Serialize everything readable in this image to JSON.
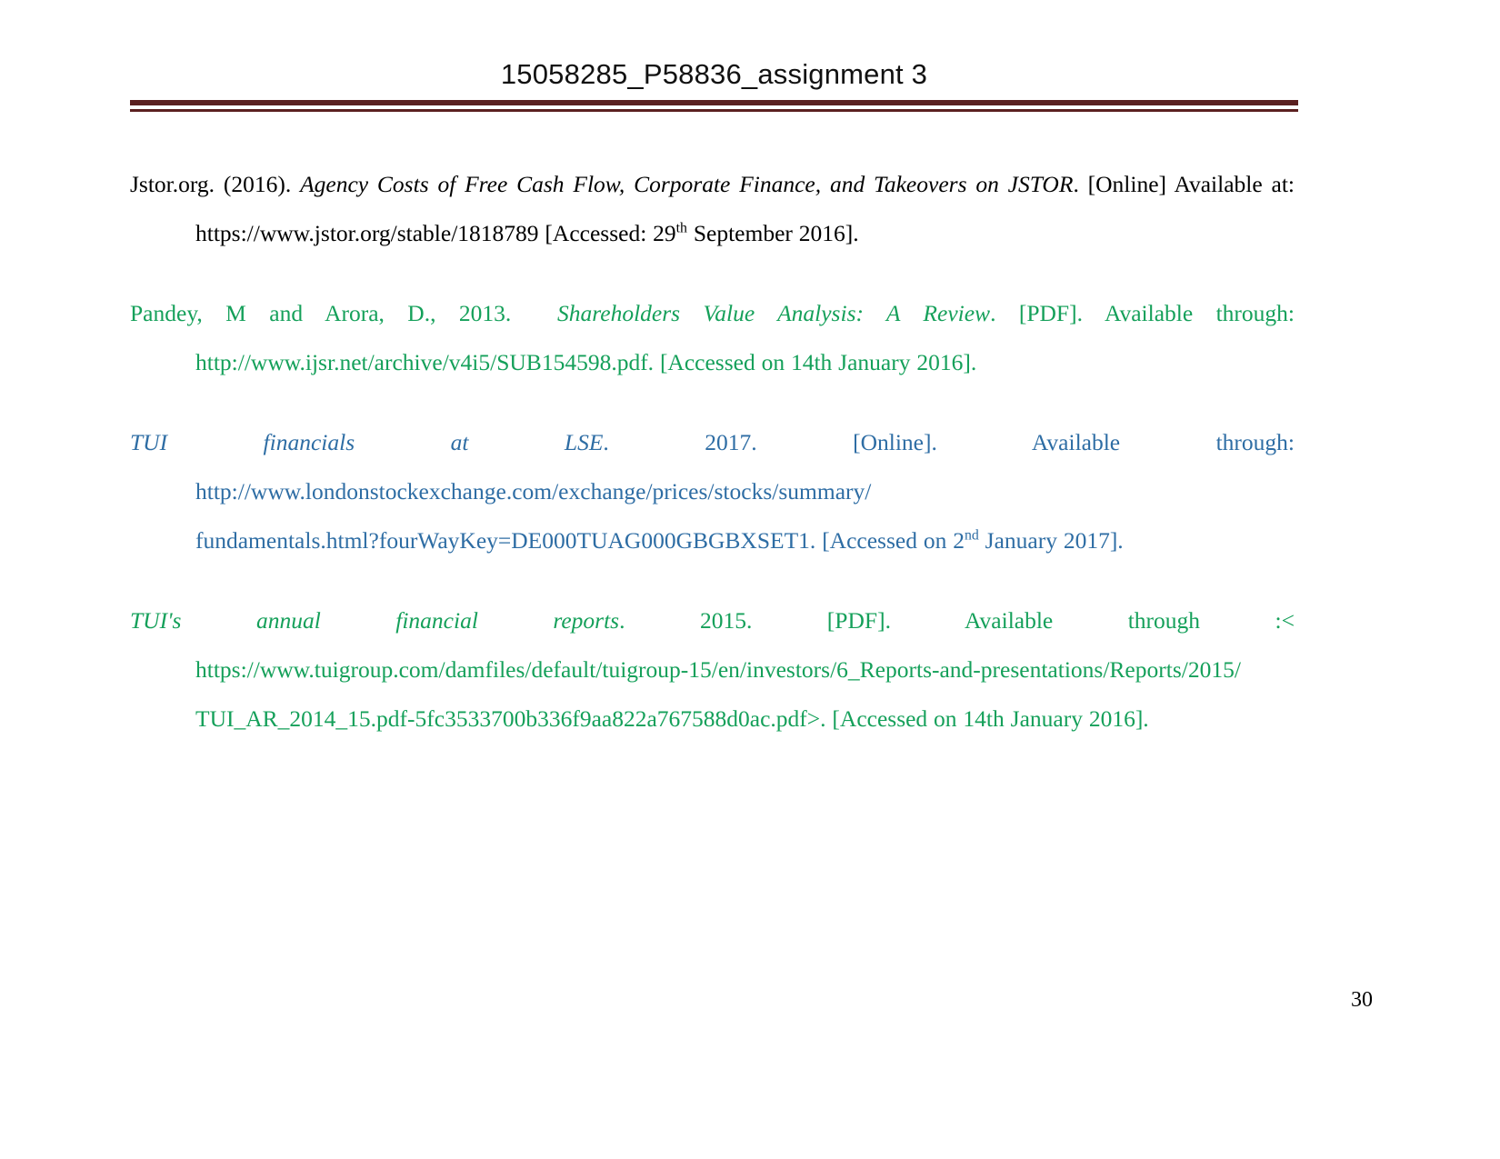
{
  "header": {
    "title": "15058285_P58836_assignment 3",
    "rule_color": "#5B2020"
  },
  "colors": {
    "black": "#000000",
    "green": "#15A05A",
    "blue": "#2E6DA4",
    "rule_maroon": "#5B2020"
  },
  "references": [
    {
      "id": "jstor-reference",
      "color": "#000000",
      "author_year": "Jstor.org.  (2016).",
      "title_italic": "Agency  Costs  of  Free  Cash  Flow,  Corporate  Finance,  and  Takeovers  on  JSTOR",
      "format_note": ". [Online]  Available  at:",
      "url": "https://www.jstor.org/stable/1818789",
      "accessed_prefix": " [Accessed:  29",
      "accessed_ordinal": "th",
      "accessed_suffix": "  September 2016].",
      "full_text": "Jstor.org. (2016). Agency Costs of Free Cash Flow, Corporate Finance, and Takeovers on JSTOR. [Online] Available at: https://www.jstor.org/stable/1818789 [Accessed: 29th September 2016]."
    },
    {
      "id": "pandey-arora-reference",
      "color": "#15A05A",
      "author_year": "Pandey,   M   and   Arora,   D.,   2013.",
      "title_italic": "Shareholders   Value   Analysis:   A   Review",
      "format_note": ". [PDF].   Available   through:",
      "url": "http://www.ijsr.net/archive/v4i5/SUB154598.pdf.",
      "accessed": " [Accessed on 14th January 2016].",
      "full_text": "Pandey, M and Arora, D., 2013. Shareholders Value Analysis: A Review. [PDF]. Available through: http://www.ijsr.net/archive/v4i5/SUB154598.pdf. [Accessed on 14th January 2016]."
    },
    {
      "id": "tui-financials-lse-reference",
      "color": "#2E6DA4",
      "title_italic": "TUI financials at LSE",
      "mid_text": ". 2017. [Online]. Available through: ",
      "url_line1": "http://www.londonstockexchange.com/exchange/prices/stocks/summary/",
      "url_line2": "fundamentals.html?fourWayKey=DE000TUAG000GBGBXSET1.",
      "accessed_prefix": " [Accessed on 2",
      "accessed_ordinal": "nd",
      "accessed_suffix": " January 2017].",
      "full_text": "TUI financials at LSE. 2017. [Online]. Available through: http://www.londonstockexchange.com/exchange/prices/stocks/summary/fundamentals.html?fourWayKey=DE000TUAG000GBGBXSET1. [Accessed on 2nd January 2017]."
    },
    {
      "id": "tui-annual-financial-reports-reference",
      "color": "#15A05A",
      "title_italic": "TUI's             annual             financial             reports",
      "mid_text": ".             2015.             [PDF].             Available             through             :<",
      "url_line1": "https://www.tuigroup.com/damfiles/default/tuigroup-15/en/investors/6_Reports-and-presentations/Reports/2015/",
      "url_line2": "TUI_AR_2014_15.pdf-5fc3533700b336f9aa822a767588d0ac.pdf>.",
      "accessed": " [Accessed on 14th January 2016].",
      "full_text": "TUI's annual financial reports. 2015. [PDF]. Available through :< https://www.tuigroup.com/damfiles/default/tuigroup-15/en/investors/6_Reports-and-presentations/Reports/2015/TUI_AR_2014_15.pdf-5fc3533700b336f9aa822a767588d0ac.pdf>. [Accessed on 14th January 2016]."
    }
  ],
  "footer": {
    "page_number": "30"
  }
}
